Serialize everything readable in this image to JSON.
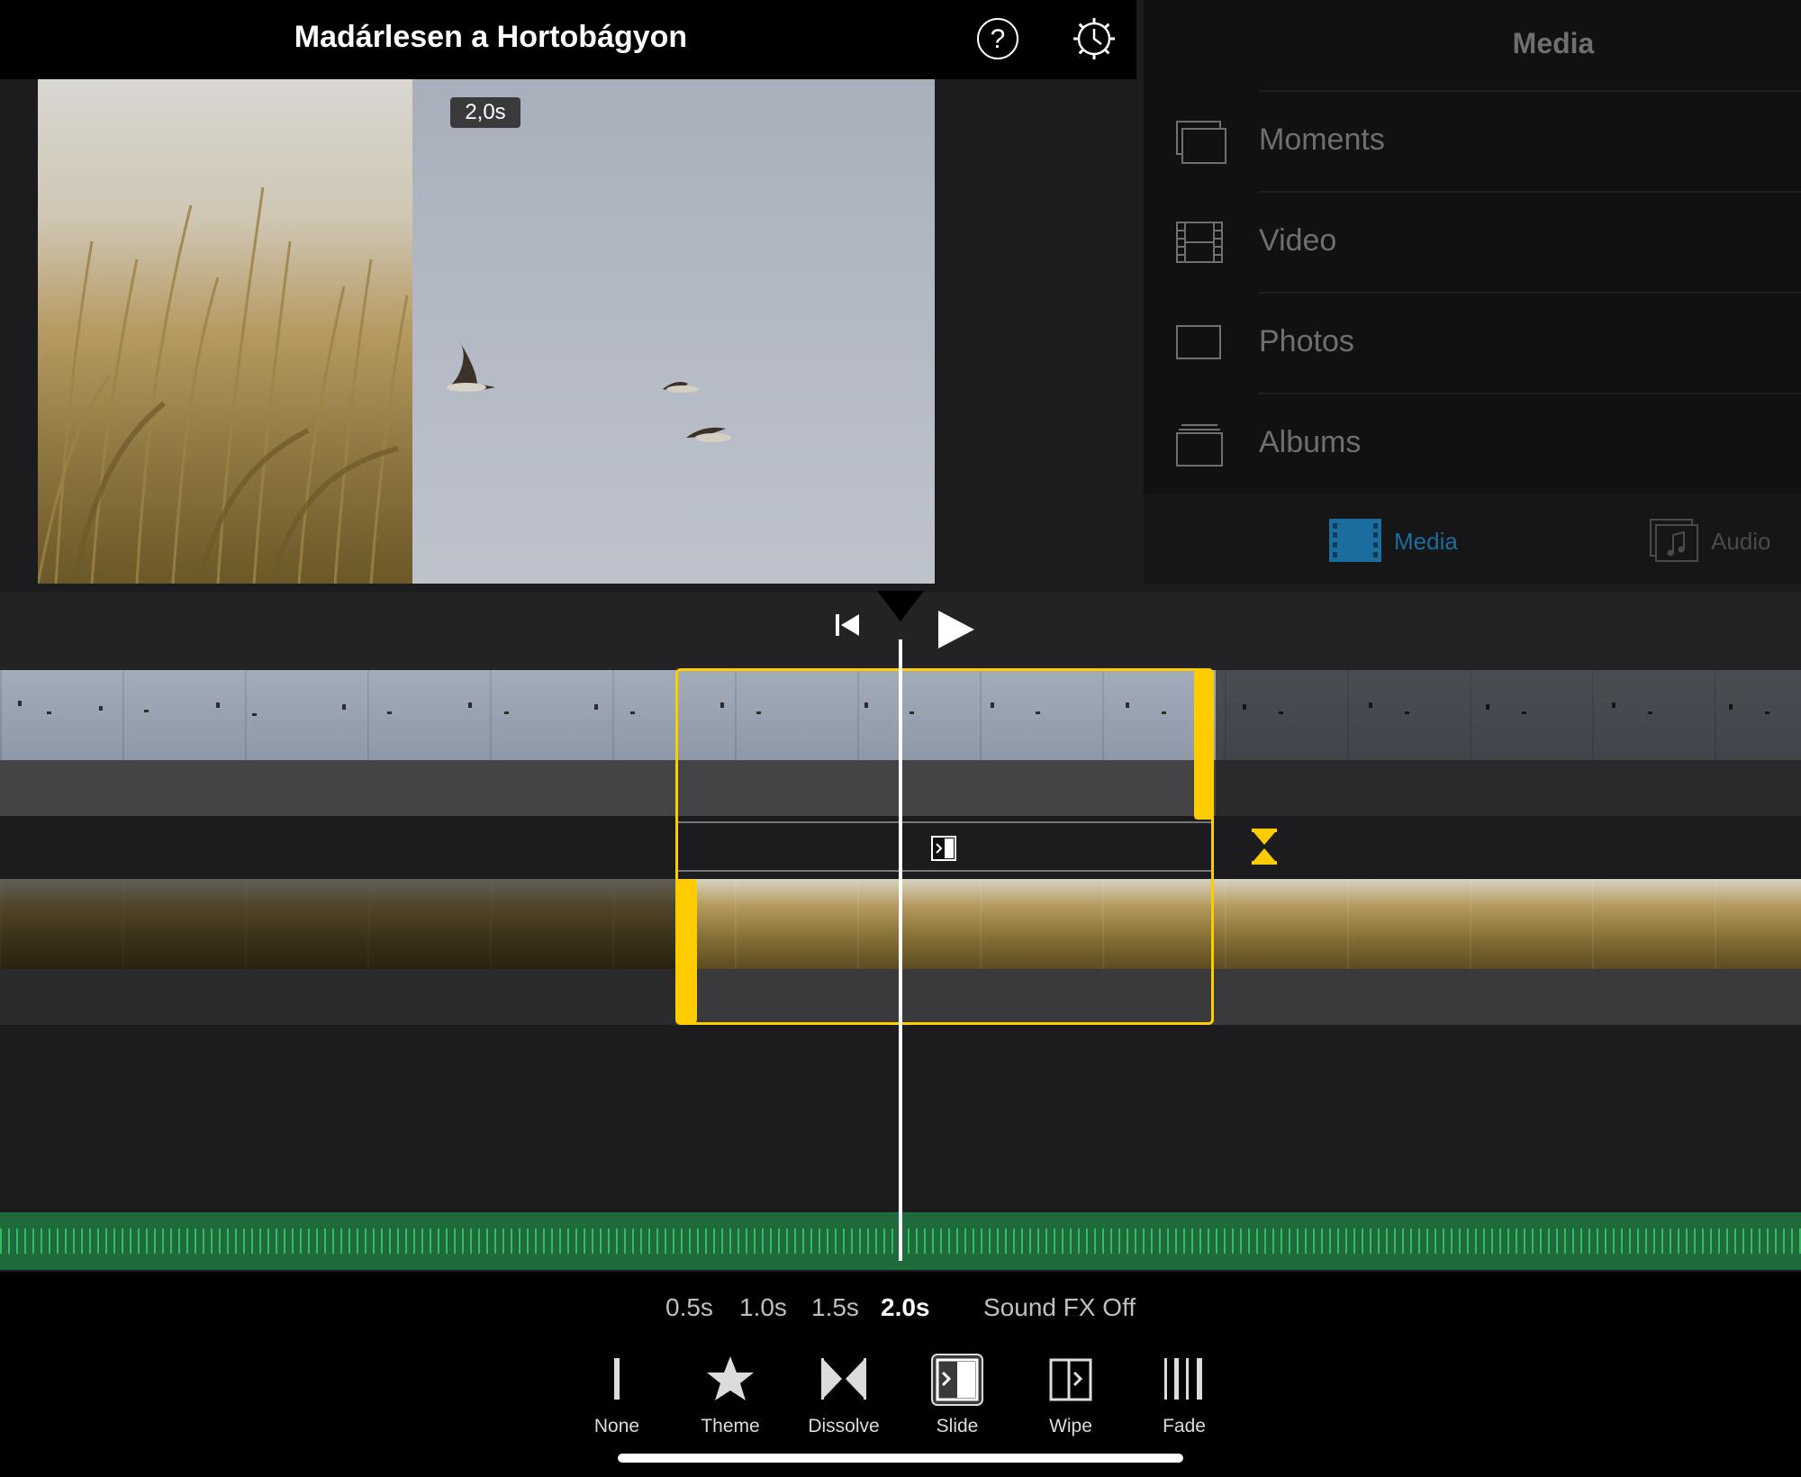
{
  "header": {
    "project_title": "Madárlesen a Hortobágyon",
    "help_glyph": "?",
    "help_icon": "help-icon",
    "settings_icon": "gear-icon"
  },
  "viewer": {
    "transition_duration_badge": "2,0s"
  },
  "media_browser": {
    "title": "Media",
    "items": [
      {
        "label": "Moments",
        "icon": "moments-icon"
      },
      {
        "label": "Video",
        "icon": "film-icon"
      },
      {
        "label": "Photos",
        "icon": "photo-icon"
      },
      {
        "label": "Albums",
        "icon": "albums-icon"
      }
    ],
    "tabs": [
      {
        "label": "Media",
        "icon": "film-icon",
        "active": true
      },
      {
        "label": "Audio",
        "icon": "music-note-icon",
        "active": false
      }
    ],
    "accent_color": "#1b6d9e"
  },
  "timeline": {
    "controls": {
      "skip_to_start_icon": "skip-to-start-icon",
      "play_icon": "play-icon"
    },
    "selection_color": "#ffcc00",
    "audio_track_color": "#1e6a3a"
  },
  "transition_panel": {
    "durations": [
      {
        "label": "0.5s",
        "selected": false
      },
      {
        "label": "1.0s",
        "selected": false
      },
      {
        "label": "1.5s",
        "selected": false
      },
      {
        "label": "2.0s",
        "selected": true
      }
    ],
    "sound_fx": "Sound FX Off",
    "types": [
      {
        "label": "None",
        "icon": "none-transition-icon",
        "selected": false
      },
      {
        "label": "Theme",
        "icon": "star-icon",
        "selected": false
      },
      {
        "label": "Dissolve",
        "icon": "dissolve-icon",
        "selected": false
      },
      {
        "label": "Slide",
        "icon": "slide-icon",
        "selected": true
      },
      {
        "label": "Wipe",
        "icon": "wipe-icon",
        "selected": false
      },
      {
        "label": "Fade",
        "icon": "fade-icon",
        "selected": false
      }
    ]
  }
}
